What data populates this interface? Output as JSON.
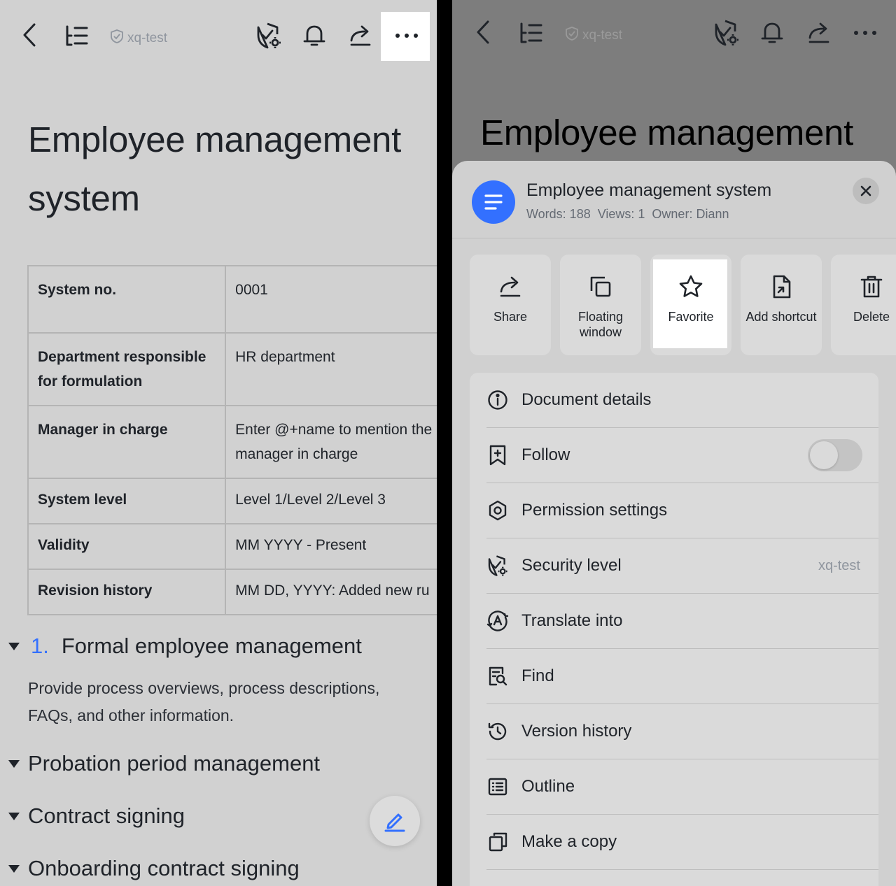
{
  "left": {
    "toolbar": {
      "security_tag": "xq-test",
      "icons": [
        "back-icon",
        "outline-icon",
        "shield-icon",
        "security-settings-icon",
        "bell-icon",
        "share-icon",
        "more-icon"
      ]
    },
    "doc_title": "Employee management system",
    "table": [
      {
        "key": "System no.",
        "value": "0001"
      },
      {
        "key": "Department responsible for formulation",
        "value": "HR department"
      },
      {
        "key": "Manager in charge",
        "value": "Enter @+name to mention the manager in charge"
      },
      {
        "key": "System level",
        "value": "Level 1/Level 2/Level 3"
      },
      {
        "key": "Validity",
        "value": "MM YYYY - Present"
      },
      {
        "key": "Revision history",
        "value": "MM DD, YYYY: Added new ru"
      }
    ],
    "sections": [
      {
        "number": "1.",
        "title": "Formal employee management"
      },
      {
        "title": "Probation period management"
      },
      {
        "title": "Contract signing"
      },
      {
        "title": "Onboarding contract signing"
      }
    ],
    "section_paragraph": "Provide process overviews, process descriptions, FAQs, and other information."
  },
  "right": {
    "toolbar": {
      "security_tag": "xq-test"
    },
    "bg_title": "Employee management",
    "sheet": {
      "title": "Employee management system",
      "meta": {
        "words": "Words: 188",
        "views": "Views: 1",
        "owner": "Owner: Diann"
      },
      "actions": [
        {
          "label": "Share",
          "icon": "share-icon"
        },
        {
          "label": "Floating window",
          "icon": "floating-window-icon"
        },
        {
          "label": "Favorite",
          "icon": "star-icon"
        },
        {
          "label": "Add shortcut",
          "icon": "shortcut-icon"
        },
        {
          "label": "Delete",
          "icon": "trash-icon"
        }
      ],
      "menu": [
        {
          "label": "Document details",
          "icon": "info-icon"
        },
        {
          "label": "Follow",
          "icon": "bookmark-plus-icon",
          "toggle": false
        },
        {
          "label": "Permission settings",
          "icon": "gear-icon"
        },
        {
          "label": "Security level",
          "icon": "security-settings-icon",
          "value": "xq-test"
        },
        {
          "label": "Translate into",
          "icon": "translate-icon"
        },
        {
          "label": "Find",
          "icon": "find-icon"
        },
        {
          "label": "Version history",
          "icon": "history-icon"
        },
        {
          "label": "Outline",
          "icon": "outline-list-icon"
        },
        {
          "label": "Make a copy",
          "icon": "copy-icon"
        }
      ]
    }
  },
  "colors": {
    "accent": "#3370ff",
    "text": "#1f2329",
    "muted": "#8f959e"
  }
}
